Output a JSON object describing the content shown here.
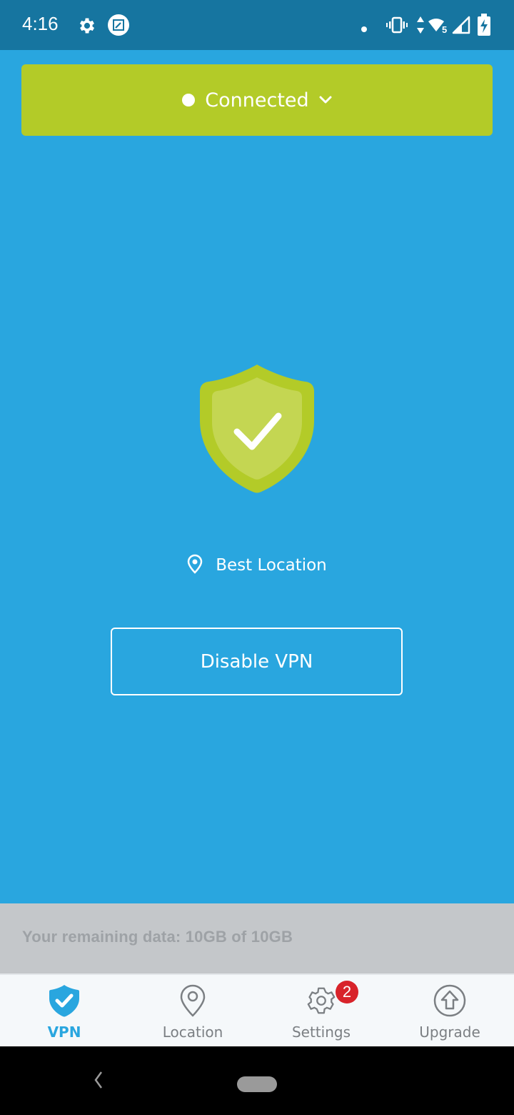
{
  "status_bar": {
    "time": "4:16",
    "left_icons": [
      "gear-icon",
      "screenshot-edit-icon"
    ],
    "right_icons": [
      "notification-dot-icon",
      "vibrate-icon",
      "data-arrows-icon",
      "wifi-5-icon",
      "cell-signal-icon",
      "battery-charging-icon"
    ],
    "wifi_label": "5"
  },
  "connection": {
    "status_label": "Connected",
    "color": "#b3cb28"
  },
  "main": {
    "background": "#29a6df",
    "shield_state": "protected",
    "location_label": "Best Location",
    "disable_button_label": "Disable VPN"
  },
  "data_usage": {
    "text": "Your remaining data: 10GB of 10GB"
  },
  "tabs": [
    {
      "label": "VPN",
      "icon": "shield-check-icon",
      "active": true
    },
    {
      "label": "Location",
      "icon": "location-pin-icon",
      "active": false
    },
    {
      "label": "Settings",
      "icon": "gear-icon",
      "active": false,
      "badge": "2"
    },
    {
      "label": "Upgrade",
      "icon": "upgrade-arrow-icon",
      "active": false
    }
  ],
  "colors": {
    "accent": "#29a6df",
    "status_bar": "#1675a0",
    "connected_green": "#b3cb28",
    "badge_red": "#d8232a"
  }
}
